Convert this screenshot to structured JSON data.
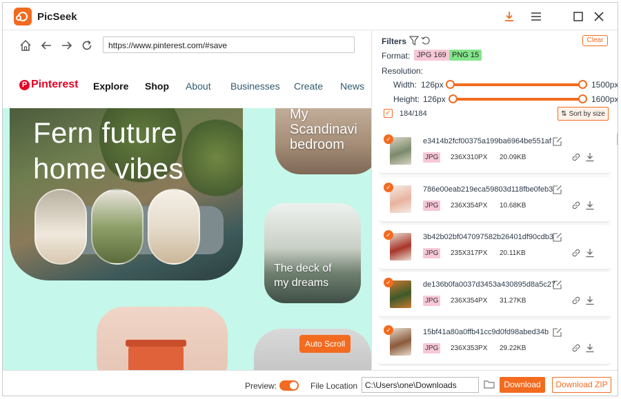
{
  "app": {
    "title": "PicSeek"
  },
  "titlebar": {
    "icons": [
      "download-icon",
      "menu-icon",
      "maximize-icon",
      "close-icon"
    ]
  },
  "browser": {
    "url": "https://www.pinterest.com/#save",
    "site": {
      "logo": "Pinterest",
      "nav": [
        "Explore",
        "Shop",
        "About",
        "Businesses",
        "Create",
        "News"
      ],
      "hero_title_line1": "Fern future",
      "hero_title_line2": "home vibes",
      "card1_lines": [
        "My",
        "Scandinavi",
        "bedroom"
      ],
      "card2_lines": [
        "The deck of",
        "my dreams"
      ],
      "auto_scroll": "Auto Scroll"
    }
  },
  "filters": {
    "label": "Filters",
    "clear": "Clear",
    "format_label": "Format:",
    "format_jpg": "JPG 169",
    "format_png": "PNG 15",
    "resolution_label": "Resolution:",
    "width_label": "Width:",
    "width_min": "126px",
    "width_max": "1500px",
    "height_label": "Height:",
    "height_min": "126px",
    "height_max": "1600px",
    "count": "184/184",
    "sort": "Sort by size"
  },
  "images": [
    {
      "name": "e3414b2fcf00375a199ba6964be551af",
      "type": "JPG",
      "dims": "236X310PX",
      "size": "20.09KB",
      "colors": [
        "#7b8a6a",
        "#d9d4c5"
      ]
    },
    {
      "name": "786e00eab219eca59803d118fbe0feb3",
      "type": "JPG",
      "dims": "236X354PX",
      "size": "10.68KB",
      "colors": [
        "#e9b3a0",
        "#f3ece5"
      ]
    },
    {
      "name": "3b42b02bf047097582b26401df90cdb3",
      "type": "JPG",
      "dims": "235X317PX",
      "size": "20.11KB",
      "colors": [
        "#a8352a",
        "#e8ddd0"
      ]
    },
    {
      "name": "de136b0fa0037d3453a430895d8a5c27",
      "type": "JPG",
      "dims": "236X354PX",
      "size": "31.27KB",
      "colors": [
        "#3d5a2a",
        "#c8782f"
      ]
    },
    {
      "name": "15bf41a80a0ffb41cc9d0fd98abed34b",
      "type": "JPG",
      "dims": "236X353PX",
      "size": "29.22KB",
      "colors": [
        "#8a5a3a",
        "#e6dccf"
      ]
    }
  ],
  "bottom": {
    "preview": "Preview:",
    "file_location": "File Location",
    "path": "C:\\Users\\one\\Downloads",
    "download": "Download",
    "download_zip": "Download ZIP"
  },
  "colors": {
    "accent": "#f26b1f",
    "pinterest": "#e60023",
    "mint": "#c5f7ea"
  }
}
